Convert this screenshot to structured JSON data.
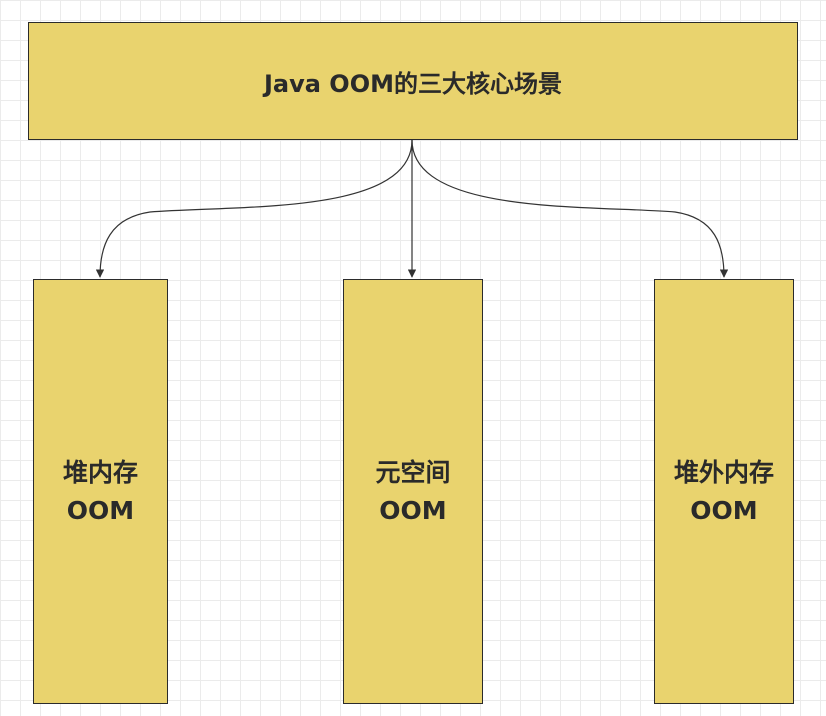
{
  "diagram": {
    "root": {
      "label": "Java OOM的三大核心场景"
    },
    "children": [
      {
        "line1": "堆内存",
        "line2": "OOM"
      },
      {
        "line1": "元空间",
        "line2": "OOM"
      },
      {
        "line1": "堆外内存",
        "line2": "OOM"
      }
    ],
    "colors": {
      "node_fill": "#e9d36e",
      "node_border": "#2b2b2b",
      "edge": "#333333",
      "grid": "#ebebeb"
    }
  }
}
